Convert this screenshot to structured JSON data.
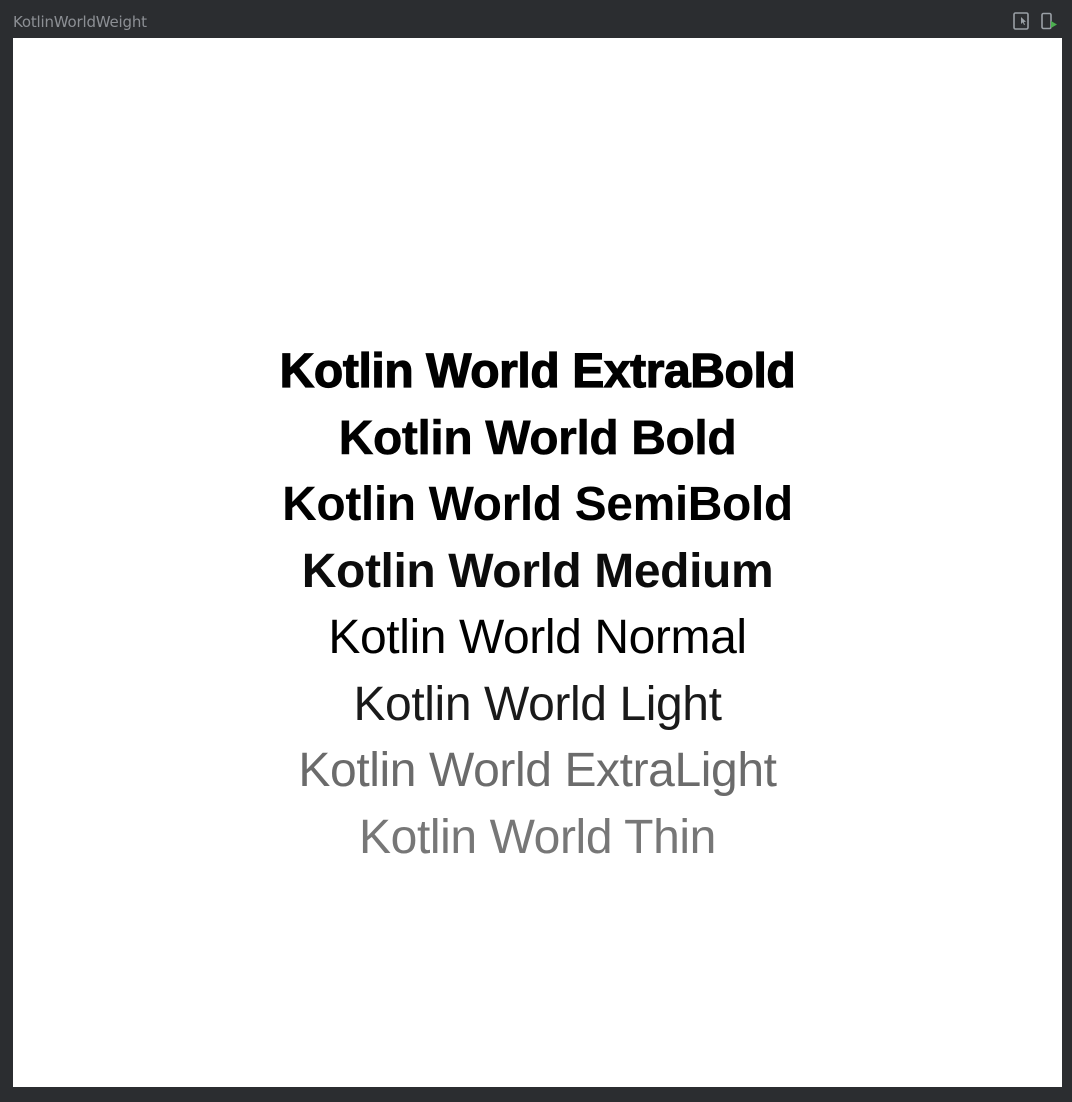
{
  "window": {
    "title": "KotlinWorldWeight"
  },
  "toolbar": {
    "interactive_mode_icon": "interactive-mode-icon",
    "deploy_icon": "deploy-to-device-icon",
    "deploy_accent": "#4caf50"
  },
  "preview": {
    "background": "#ffffff",
    "lines": [
      "Kotlin World ExtraBold",
      "Kotlin World Bold",
      "Kotlin World SemiBold",
      "Kotlin World Medium",
      "Kotlin World Normal",
      "Kotlin World Light",
      "Kotlin World ExtraLight",
      "Kotlin World Thin"
    ]
  }
}
